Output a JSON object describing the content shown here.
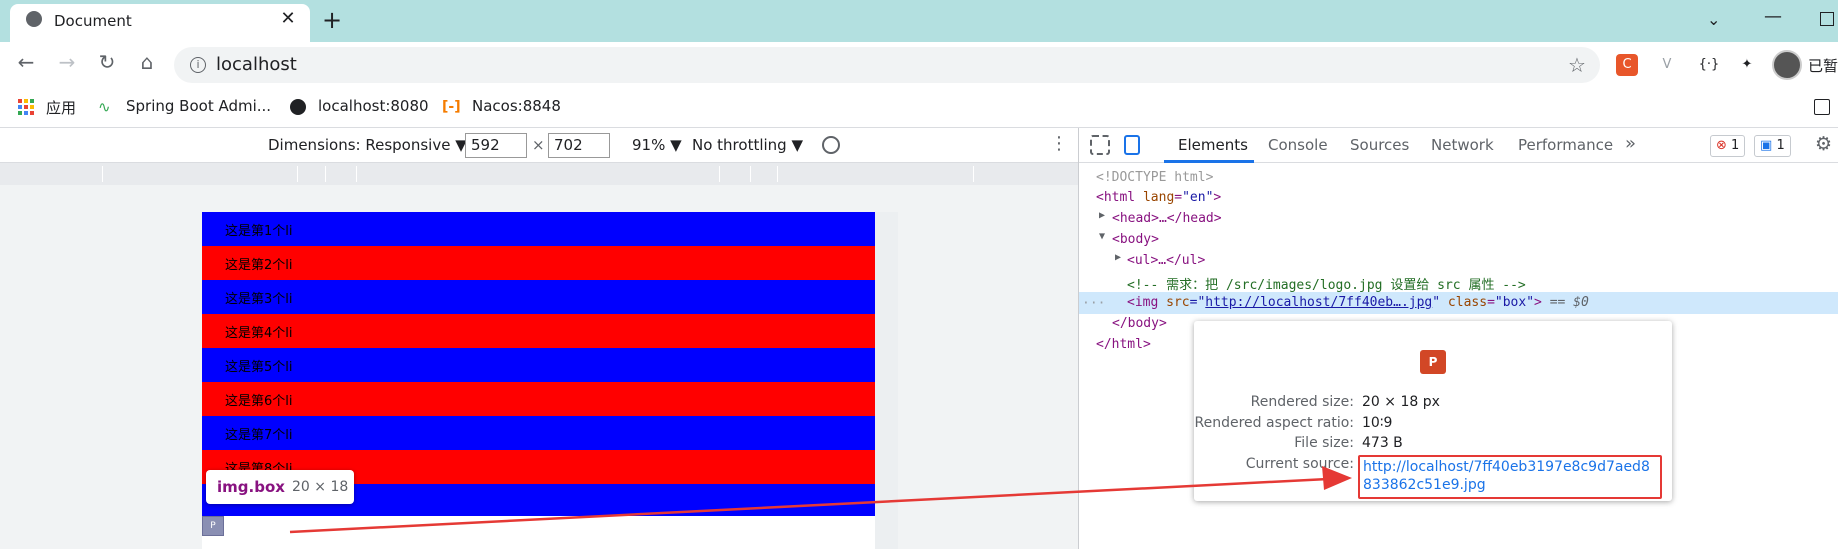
{
  "browser": {
    "tab_title": "Document",
    "tab_close": "✕",
    "new_tab": "+",
    "address": "localhost",
    "profile_label": "已暂",
    "extensions": [
      {
        "name": "extension-c",
        "glyph": "C",
        "color": "#e8562a"
      },
      {
        "name": "extension-v",
        "glyph": "V",
        "color": "#9aa0a6"
      },
      {
        "name": "extension-braces",
        "glyph": "{·}",
        "color": "#202124"
      }
    ]
  },
  "bookmarks": [
    {
      "label": "应用"
    },
    {
      "label": "Spring Boot Admi..."
    },
    {
      "label": "localhost:8080"
    },
    {
      "label": "Nacos:8848"
    }
  ],
  "device_toolbar": {
    "dimensions": "Dimensions: Responsive ▼",
    "width": "592",
    "times": "×",
    "height": "702",
    "zoom": "91% ▼",
    "throttle": "No throttling ▼"
  },
  "page": {
    "colors": {
      "blue": "#0000ff",
      "red": "#ff0000"
    },
    "list_items": [
      "这是第1个li",
      "这是第2个li",
      "这是第3个li",
      "这是第4个li",
      "这是第5个li",
      "这是第6个li",
      "这是第7个li",
      "这是第8个li"
    ],
    "tooltip": {
      "tag": "img.box",
      "size": "20 × 18"
    },
    "img_thumb": "P"
  },
  "devtools": {
    "tabs": [
      "Elements",
      "Console",
      "Sources",
      "Network",
      "Performance"
    ],
    "more_tabs": "»",
    "errors": "1",
    "messages": "1",
    "dom": {
      "doctype": "<!DOCTYPE html>",
      "html_open_tag": "<html",
      "lang_attr": "lang",
      "lang_value": "\"en\"",
      "close_bracket": ">",
      "head_line": "<head>…</head>",
      "body_open": "<body>",
      "ul_line": "<ul>…</ul>",
      "comment": "<!-- 需求：把 /src/images/logo.jpg 设置给 src 属性 -->",
      "img_open": "<img",
      "src_attr": "src",
      "eq": "=\"",
      "src_value": "http://localhost/7ff40eb….jpg",
      "quote": "\"",
      "class_attr": "class",
      "class_value": "\"box\"",
      "selected_marker": "== $0",
      "body_close": "</body>",
      "html_close": "</html>",
      "dots": "···"
    },
    "popover": {
      "rendered_size_label": "Rendered size:",
      "rendered_size": "20 × 18 px",
      "aspect_label": "Rendered aspect ratio:",
      "aspect": "10∶9",
      "file_size_label": "File size:",
      "file_size": "473 B",
      "source_label": "Current source:",
      "source": "http://localhost/7ff40eb3197e8c9d7aed8833862c51e9.jpg",
      "preview_glyph": "P"
    }
  }
}
